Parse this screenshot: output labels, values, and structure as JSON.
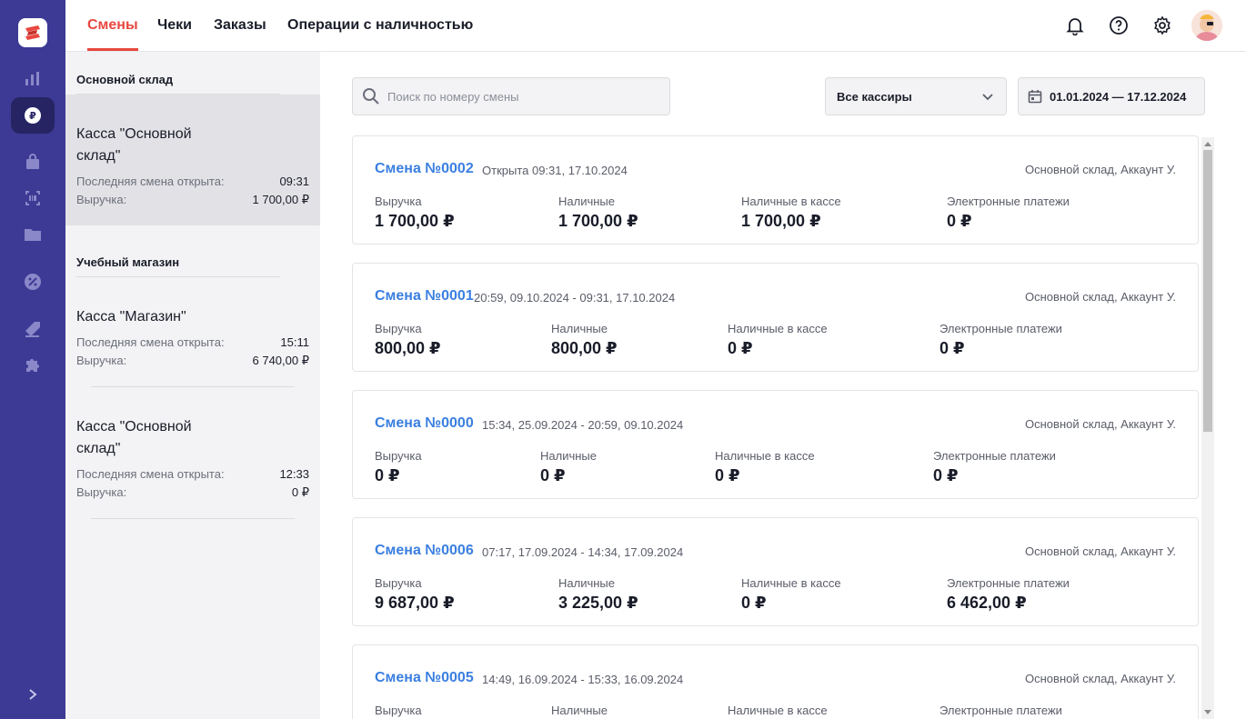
{
  "nav": {
    "tabs": [
      {
        "label": "Смены",
        "active": true
      },
      {
        "label": "Чеки",
        "active": false
      },
      {
        "label": "Заказы",
        "active": false
      },
      {
        "label": "Операции с наличностью",
        "active": false
      }
    ],
    "icons": [
      "bell-icon",
      "help-icon",
      "settings-icon",
      "user-avatar"
    ]
  },
  "rail": {
    "items": [
      "chart-icon",
      "ruble-icon",
      "bag-icon",
      "barcode-icon",
      "folder-icon",
      "discount-icon",
      "tag-icon",
      "puzzle-icon"
    ],
    "active": "ruble-icon",
    "expand_icon": "chevron-right-icon"
  },
  "panel": {
    "groups": [
      {
        "title": "Основной склад",
        "kassas": [
          {
            "name": "Касса \"Основной склад\"",
            "last_label": "Последняя смена открыта:",
            "last_value": "09:31",
            "rev_label": "Выручка:",
            "rev_value": "1 700,00 ₽",
            "selected": true
          }
        ]
      },
      {
        "title": "Учебный магазин",
        "kassas": [
          {
            "name": "Касса \"Магазин\"",
            "last_label": "Последняя смена открыта:",
            "last_value": "15:11",
            "rev_label": "Выручка:",
            "rev_value": "6 740,00 ₽",
            "selected": false
          },
          {
            "name": "Касса \"Основной склад\"",
            "last_label": "Последняя смена открыта:",
            "last_value": "12:33",
            "rev_label": "Выручка:",
            "rev_value": "0 ₽",
            "selected": false
          }
        ]
      }
    ]
  },
  "filters": {
    "search_placeholder": "Поиск по номеру смены",
    "search_value": "",
    "cashier": "Все кассиры",
    "date_range": "01.01.2024 — 17.12.2024"
  },
  "metric_labels": [
    "Выручка",
    "Наличные",
    "Наличные в кассе",
    "Электронные платежи"
  ],
  "shifts": [
    {
      "title": "Смена №0002",
      "period": "Открыта 09:31, 17.10.2024",
      "place": "Основной склад, Аккаунт У.",
      "values": [
        "1 700,00 ₽",
        "1 700,00 ₽",
        "1 700,00 ₽",
        "0 ₽"
      ]
    },
    {
      "title": "Смена №0001",
      "period": "20:59, 09.10.2024 - 09:31, 17.10.2024",
      "place": "Основной склад, Аккаунт У.",
      "values": [
        "800,00 ₽",
        "800,00 ₽",
        "0 ₽",
        "0 ₽"
      ]
    },
    {
      "title": "Смена №0000",
      "period": "15:34, 25.09.2024 - 20:59, 09.10.2024",
      "place": "Основной склад, Аккаунт У.",
      "values": [
        "0 ₽",
        "0 ₽",
        "0 ₽",
        "0 ₽"
      ]
    },
    {
      "title": "Смена №0006",
      "period": "07:17, 17.09.2024 - 14:34, 17.09.2024",
      "place": "Основной склад, Аккаунт У.",
      "values": [
        "9 687,00 ₽",
        "3 225,00 ₽",
        "0 ₽",
        "6 462,00 ₽"
      ]
    },
    {
      "title": "Смена №0005",
      "period": "14:49, 16.09.2024 - 15:33, 16.09.2024",
      "place": "Основной склад, Аккаунт У.",
      "values": [
        "",
        "",
        "",
        ""
      ]
    }
  ],
  "colors": {
    "rail": "#3c3a94",
    "accent": "#e8473f",
    "link": "#3a7fe0"
  }
}
